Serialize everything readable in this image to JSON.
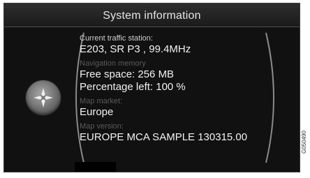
{
  "window": {
    "title": "System information"
  },
  "sections": {
    "traffic": {
      "label": "Current traffic station:",
      "value": "E203, SR P3   , 99.4MHz"
    },
    "memory": {
      "label": "Navigation memory",
      "free_space": "Free space: 256 MB",
      "percentage_left": "Percentage left: 100 %"
    },
    "market": {
      "label": "Map market:",
      "value": "Europe"
    },
    "version": {
      "label": "Map version:",
      "value": "EUROPE MCA SAMPLE 130315.00"
    }
  },
  "figure_code": "G050490",
  "icons": {
    "nav_button": "compass-icon"
  },
  "colors": {
    "screen_bg": "#111111",
    "active_label": "#cfcfcf",
    "dim_label": "#5a5a5a",
    "value_text": "#f2f2f2"
  }
}
